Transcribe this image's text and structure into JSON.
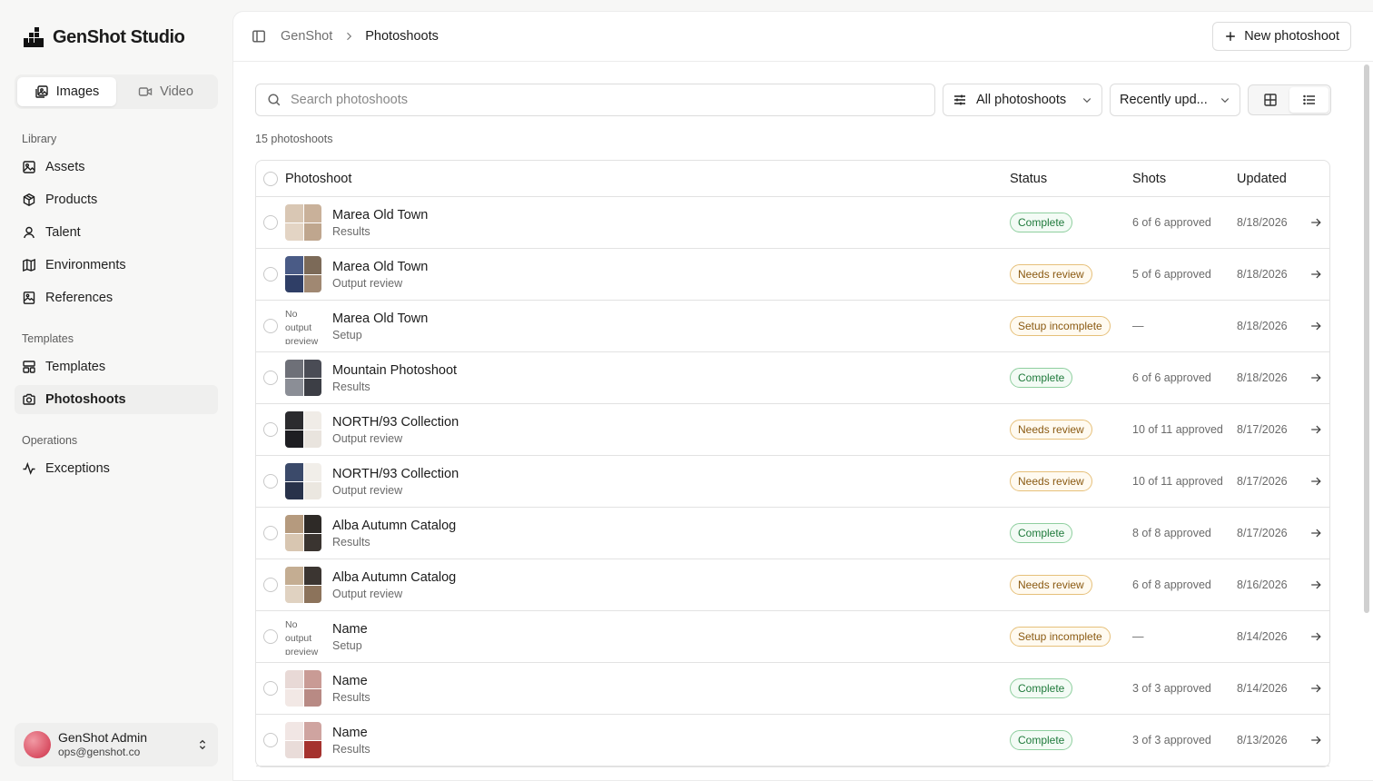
{
  "brand": {
    "name": "GenShot Studio"
  },
  "mode_toggle": {
    "images": "Images",
    "video": "Video"
  },
  "nav": {
    "library_heading": "Library",
    "library": [
      "Assets",
      "Products",
      "Talent",
      "Environments",
      "References"
    ],
    "templates_heading": "Templates",
    "templates": [
      "Templates",
      "Photoshoots"
    ],
    "operations_heading": "Operations",
    "operations": [
      "Exceptions"
    ]
  },
  "user": {
    "name": "GenShot Admin",
    "email": "ops@genshot.co"
  },
  "breadcrumb": {
    "root": "GenShot",
    "current": "Photoshoots"
  },
  "header": {
    "new_button": "New photoshoot"
  },
  "search": {
    "placeholder": "Search photoshoots"
  },
  "filters": {
    "scope": "All photoshoots",
    "sort": "Recently upd..."
  },
  "count_label": "15 photoshoots",
  "table": {
    "columns": {
      "name": "Photoshoot",
      "status": "Status",
      "shots": "Shots",
      "updated": "Updated"
    },
    "rows": [
      {
        "title": "Marea Old Town",
        "subtitle": "Results",
        "status": "Complete",
        "shots": "6 of 6 approved",
        "updated": "8/18/2026"
      },
      {
        "title": "Marea Old Town",
        "subtitle": "Output review",
        "status": "Needs review",
        "shots": "5 of 6 approved",
        "updated": "8/18/2026"
      },
      {
        "title": "Marea Old Town",
        "subtitle": "Setup",
        "status": "Setup incomplete",
        "shots": "—",
        "updated": "8/18/2026",
        "thumb_text": "No output preview"
      },
      {
        "title": "Mountain Photoshoot",
        "subtitle": "Results",
        "status": "Complete",
        "shots": "6 of 6 approved",
        "updated": "8/18/2026"
      },
      {
        "title": "NORTH/93 Collection",
        "subtitle": "Output review",
        "status": "Needs review",
        "shots": "10 of 11 approved",
        "updated": "8/17/2026"
      },
      {
        "title": "NORTH/93 Collection",
        "subtitle": "Output review",
        "status": "Needs review",
        "shots": "10 of 11 approved",
        "updated": "8/17/2026"
      },
      {
        "title": "Alba Autumn Catalog",
        "subtitle": "Results",
        "status": "Complete",
        "shots": "8 of 8 approved",
        "updated": "8/17/2026"
      },
      {
        "title": "Alba Autumn Catalog",
        "subtitle": "Output review",
        "status": "Needs review",
        "shots": "6 of 8 approved",
        "updated": "8/16/2026"
      },
      {
        "title": "Name",
        "subtitle": "Setup",
        "status": "Setup incomplete",
        "shots": "—",
        "updated": "8/14/2026",
        "thumb_text": "No output preview"
      },
      {
        "title": "Name",
        "subtitle": "Results",
        "status": "Complete",
        "shots": "3 of 3 approved",
        "updated": "8/14/2026"
      },
      {
        "title": "Name",
        "subtitle": "Results",
        "status": "Complete",
        "shots": "3 of 3 approved",
        "updated": "8/13/2026"
      }
    ]
  },
  "colors": {
    "complete": "#1f7a3b",
    "needs_review": "#8a5a12",
    "thumb_palettes": [
      [
        "#d9c7b4",
        "#c9b19a",
        "#e3d4c4",
        "#bfa68e"
      ],
      [
        "#4a5b86",
        "#7c6a58",
        "#2f3e66",
        "#a08872"
      ],
      null,
      [
        "#6e7078",
        "#4a4c55",
        "#8b8e96",
        "#3c3e45"
      ],
      [
        "#2b2b2e",
        "#f0ece7",
        "#1e1e22",
        "#e9e4de"
      ],
      [
        "#3b4a6a",
        "#f1eee9",
        "#28324a",
        "#ebe7e0"
      ],
      [
        "#b59a7e",
        "#2e2a27",
        "#d8c6b1",
        "#3a3430"
      ],
      [
        "#c4ad92",
        "#3b3531",
        "#e0d2c1",
        "#8c735b"
      ],
      null,
      [
        "#e8d9d6",
        "#c99b95",
        "#f2e8e5",
        "#b88a84"
      ],
      [
        "#f1e6e4",
        "#cfa4a0",
        "#e9dcd9",
        "#a5322e"
      ]
    ]
  }
}
